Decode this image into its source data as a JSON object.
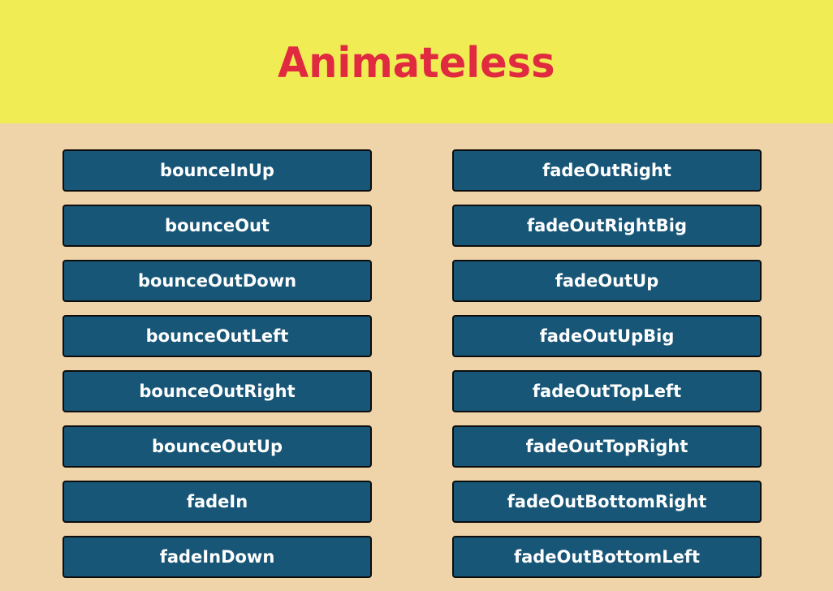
{
  "header": {
    "title": "Animateless"
  },
  "colors": {
    "header_bg": "#f0ec54",
    "page_bg": "#efd4a9",
    "title": "#e02a3f",
    "button_bg": "#185677",
    "button_text": "#ffffff"
  },
  "buttons": {
    "left": [
      "bounceInUp",
      "bounceOut",
      "bounceOutDown",
      "bounceOutLeft",
      "bounceOutRight",
      "bounceOutUp",
      "fadeIn",
      "fadeInDown"
    ],
    "right": [
      "fadeOutRight",
      "fadeOutRightBig",
      "fadeOutUp",
      "fadeOutUpBig",
      "fadeOutTopLeft",
      "fadeOutTopRight",
      "fadeOutBottomRight",
      "fadeOutBottomLeft"
    ]
  }
}
